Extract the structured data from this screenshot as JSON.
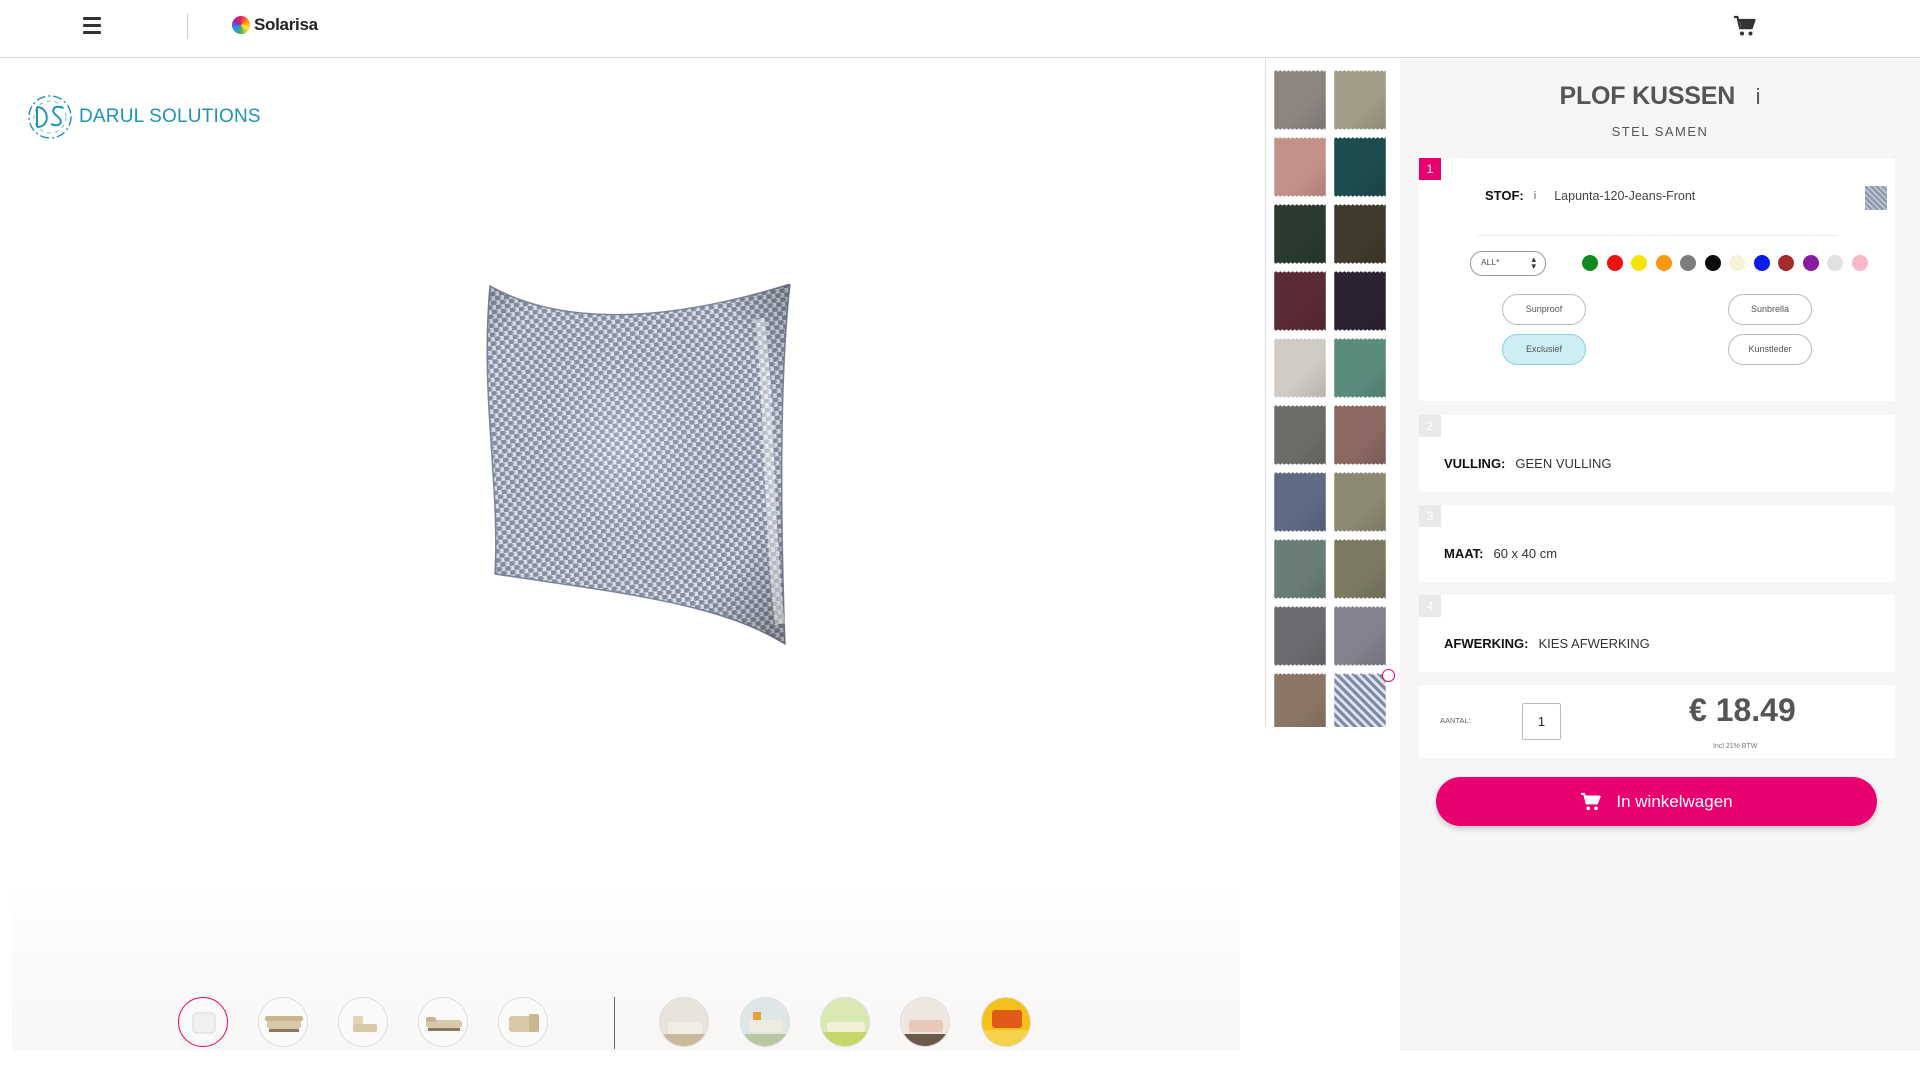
{
  "header": {
    "brand": "Solarisa"
  },
  "viewer": {
    "logo_text": "DARUL SOLUTIONS"
  },
  "product": {
    "title": "PLOF KUSSEN",
    "info": "i",
    "subtitle": "STEL SAMEN"
  },
  "steps": [
    {
      "number": "1",
      "label": "STOF:",
      "info": "i",
      "value": "Lapunta-120-Jeans-Front"
    },
    {
      "number": "2",
      "label": "VULLING:",
      "value": "GEEN VULLING"
    },
    {
      "number": "3",
      "label": "MAAT:",
      "value": "60 x 40 cm"
    },
    {
      "number": "4",
      "label": "AFWERKING:",
      "value": "KIES AFWERKING"
    }
  ],
  "filter": {
    "select_value": "ALL*",
    "colors": [
      "#0f8a1f",
      "#ee1111",
      "#f4e30f",
      "#f59a12",
      "#7d7d7d",
      "#0a0a0a",
      "#f6f2dc",
      "#0b1ce8",
      "#a52a2a",
      "#8a1aa0",
      "#e1e1e1",
      "#f7b8c8"
    ],
    "pills": [
      {
        "label": "Sunproof",
        "active": false
      },
      {
        "label": "Sunbrella",
        "active": false
      },
      {
        "label": "Exclusief",
        "active": true
      },
      {
        "label": "Kunstleder",
        "active": false
      }
    ]
  },
  "order": {
    "quantity_label": "AANTAL:",
    "quantity": "1",
    "price": "€ 18.49",
    "vat_note": "Incl 21% BTW",
    "cta_label": "In winkelwagen"
  },
  "swatch_colors": [
    "#8c8580",
    "#a39c86",
    "#c49189",
    "#1c4c4d",
    "#2a3a2f",
    "#3f3a2b",
    "#5a2a35",
    "#2b2233",
    "#cfcac3",
    "#5a8c7e",
    "#6e6c68",
    "#8d6762",
    "#5f6a84",
    "#8c8a70",
    "#6a7d78",
    "#7d7a62",
    "#6c6b6f",
    "#84808e",
    "#8b7665",
    "#8d97ab"
  ],
  "selected_swatch_index": 19,
  "active_thumb_index": 0
}
